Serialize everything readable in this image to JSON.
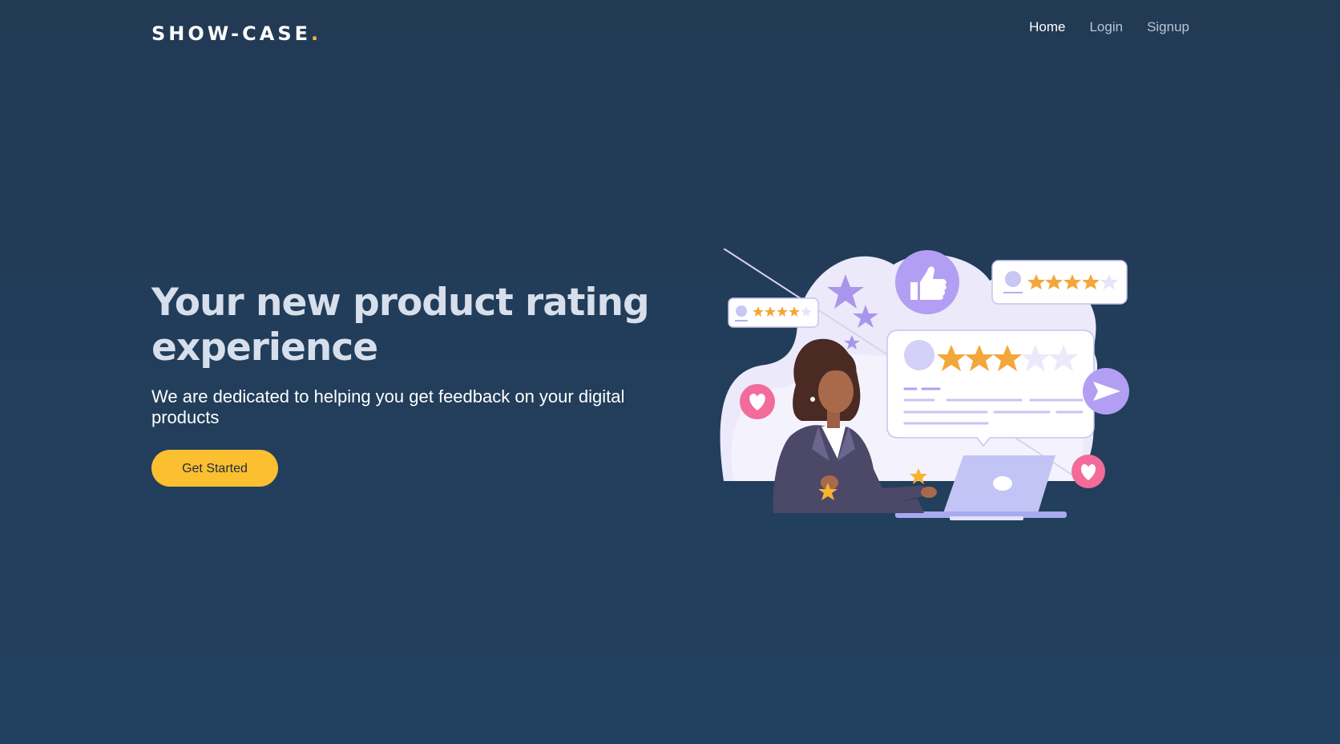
{
  "brand": {
    "name": "SHOW-CASE",
    "dot": "."
  },
  "nav": {
    "items": [
      {
        "label": "Home",
        "active": true
      },
      {
        "label": "Login",
        "active": false
      },
      {
        "label": "Signup",
        "active": false
      }
    ]
  },
  "hero": {
    "headline": "Your new product rating experience",
    "subtitle": "We are dedicated to helping you get feedback on your digital products",
    "cta_label": "Get Started"
  },
  "illustration": {
    "ratings": {
      "small_card": 4,
      "top_card": 4,
      "main_card": 3,
      "max": 5
    }
  },
  "colors": {
    "background": "#223d5a",
    "accent": "#fbbf2f",
    "illustration_purple": "#b7a3f4",
    "heart_pink": "#f36b9a"
  }
}
